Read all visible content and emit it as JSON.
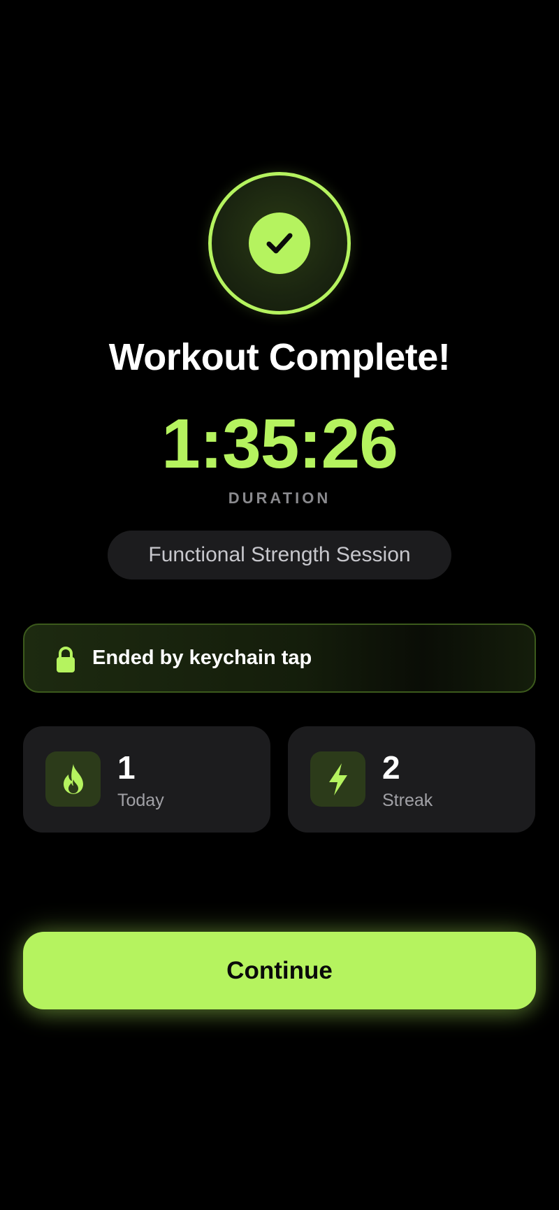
{
  "header": {
    "title": "Workout Complete!"
  },
  "summary": {
    "duration_value": "1:35:26",
    "duration_label": "DURATION",
    "session_name": "Functional Strength Session"
  },
  "ended_banner": {
    "text": "Ended by keychain tap",
    "icon": "lock-icon"
  },
  "stats": [
    {
      "value": "1",
      "label": "Today",
      "icon": "flame-icon"
    },
    {
      "value": "2",
      "label": "Streak",
      "icon": "lightning-icon"
    }
  ],
  "actions": {
    "continue_label": "Continue"
  },
  "colors": {
    "accent": "#b5f35f",
    "background": "#000000",
    "card": "#1c1c1e",
    "muted_text": "#8a8a8e"
  }
}
